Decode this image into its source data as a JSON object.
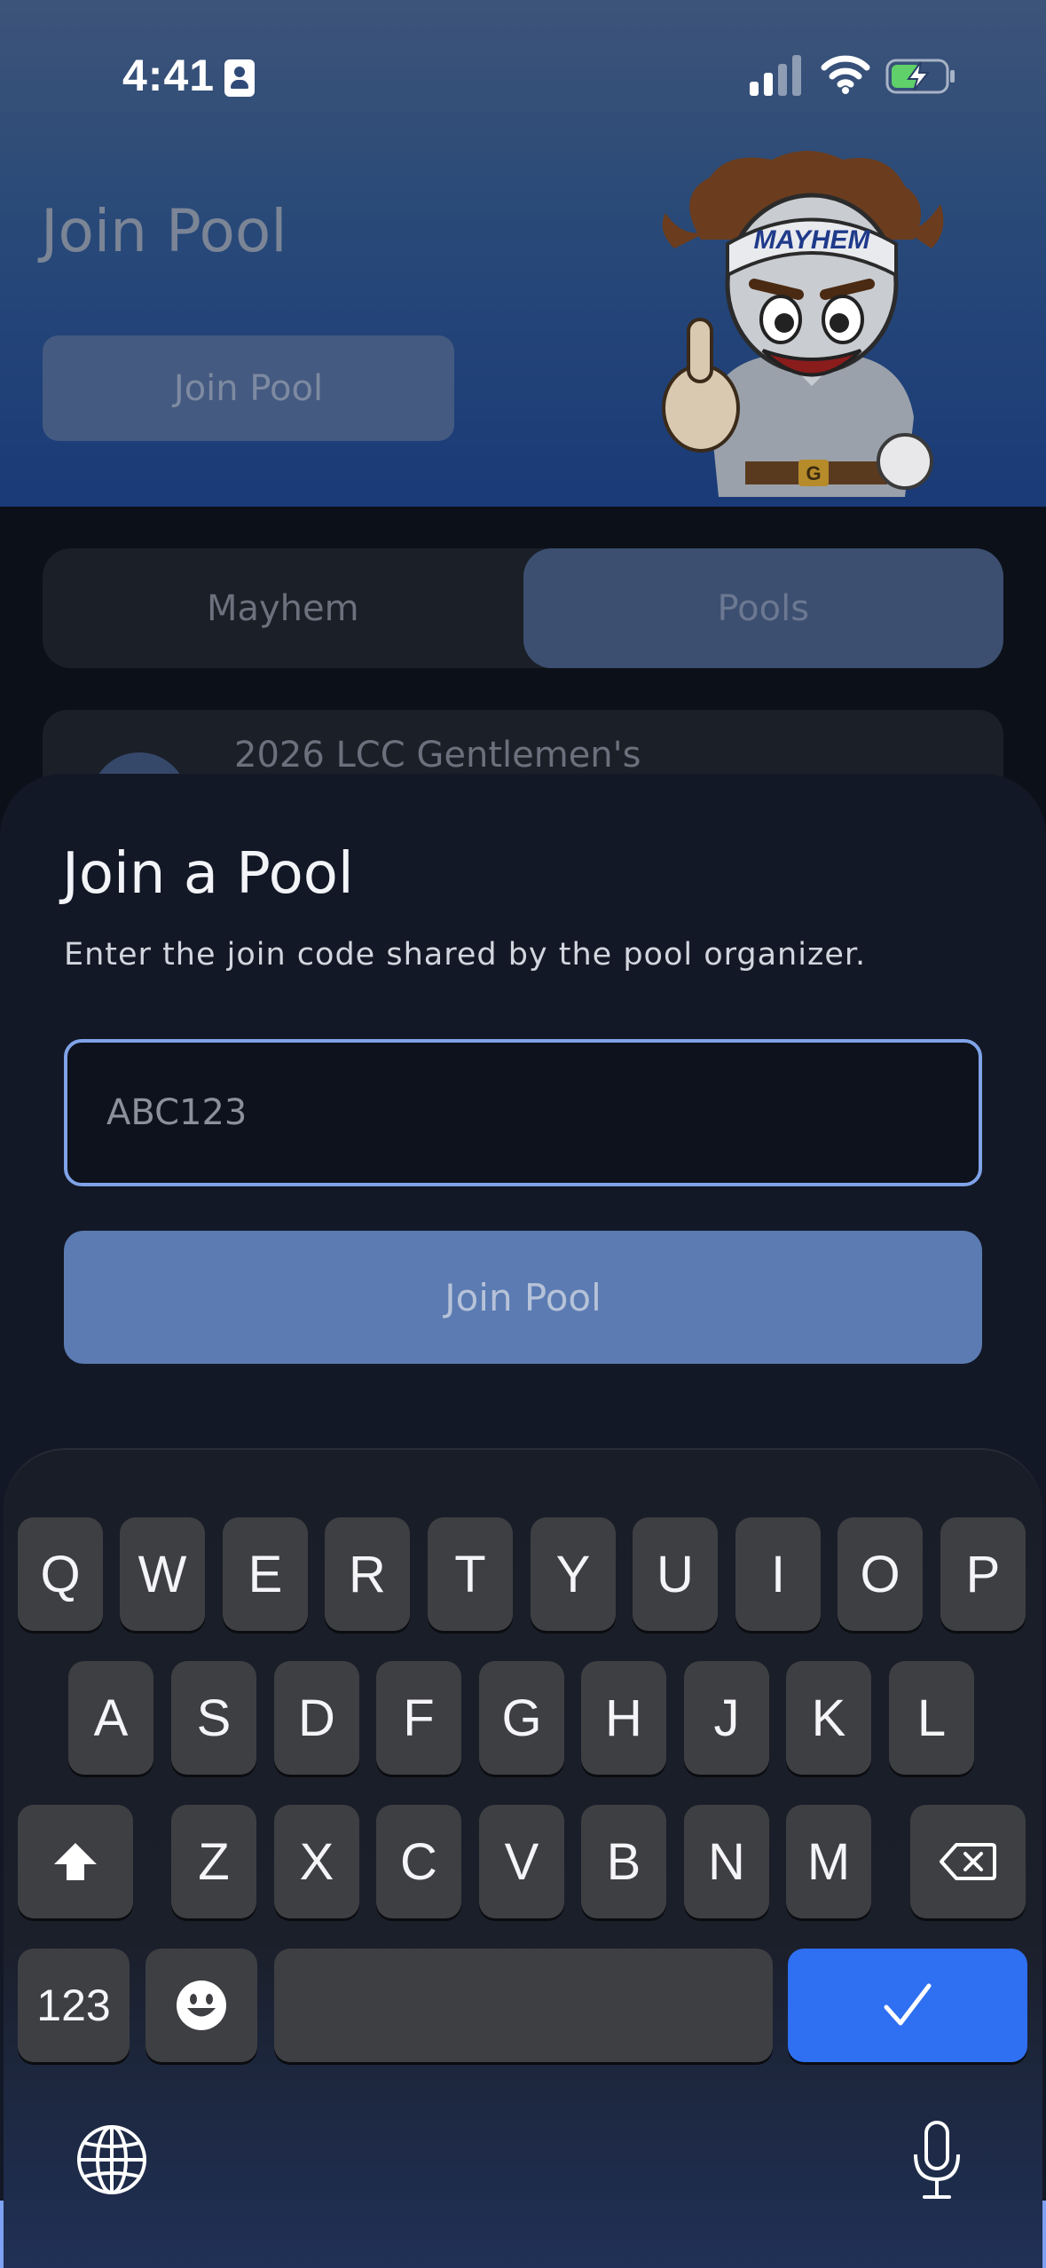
{
  "status_bar": {
    "time": "4:41",
    "icons": [
      "id-badge-icon",
      "cellular-signal-icon",
      "wifi-icon",
      "battery-charging-icon"
    ]
  },
  "header": {
    "title": "Join Pool",
    "button_label": "Join Pool",
    "mascot_cap_text": "MAYHEM",
    "mascot_buckle_text": "G"
  },
  "segmented_control": {
    "tabs": [
      {
        "label": "Mayhem",
        "active": false
      },
      {
        "label": "Pools",
        "active": true
      }
    ]
  },
  "pool_list": {
    "items": [
      {
        "name": "2026 LCC Gentlemen's"
      }
    ]
  },
  "sheet": {
    "title": "Join a Pool",
    "subtitle": "Enter the join code shared by the pool organizer.",
    "code_input": {
      "value": "",
      "placeholder": "ABC123"
    },
    "join_button_label": "Join Pool"
  },
  "keyboard": {
    "row1": [
      "Q",
      "W",
      "E",
      "R",
      "T",
      "Y",
      "U",
      "I",
      "O",
      "P"
    ],
    "row2": [
      "A",
      "S",
      "D",
      "F",
      "G",
      "H",
      "J",
      "K",
      "L"
    ],
    "row3": [
      "Z",
      "X",
      "C",
      "V",
      "B",
      "N",
      "M"
    ],
    "numbers_key_label": "123",
    "icons": [
      "shift-icon",
      "backspace-icon",
      "emoji-icon",
      "checkmark-icon",
      "globe-icon",
      "microphone-icon"
    ]
  },
  "colors": {
    "accent": "#2f6ff1",
    "input_border": "#7fa3e8",
    "join_button": "#5b7bb2",
    "sheet_background": "#131826"
  }
}
